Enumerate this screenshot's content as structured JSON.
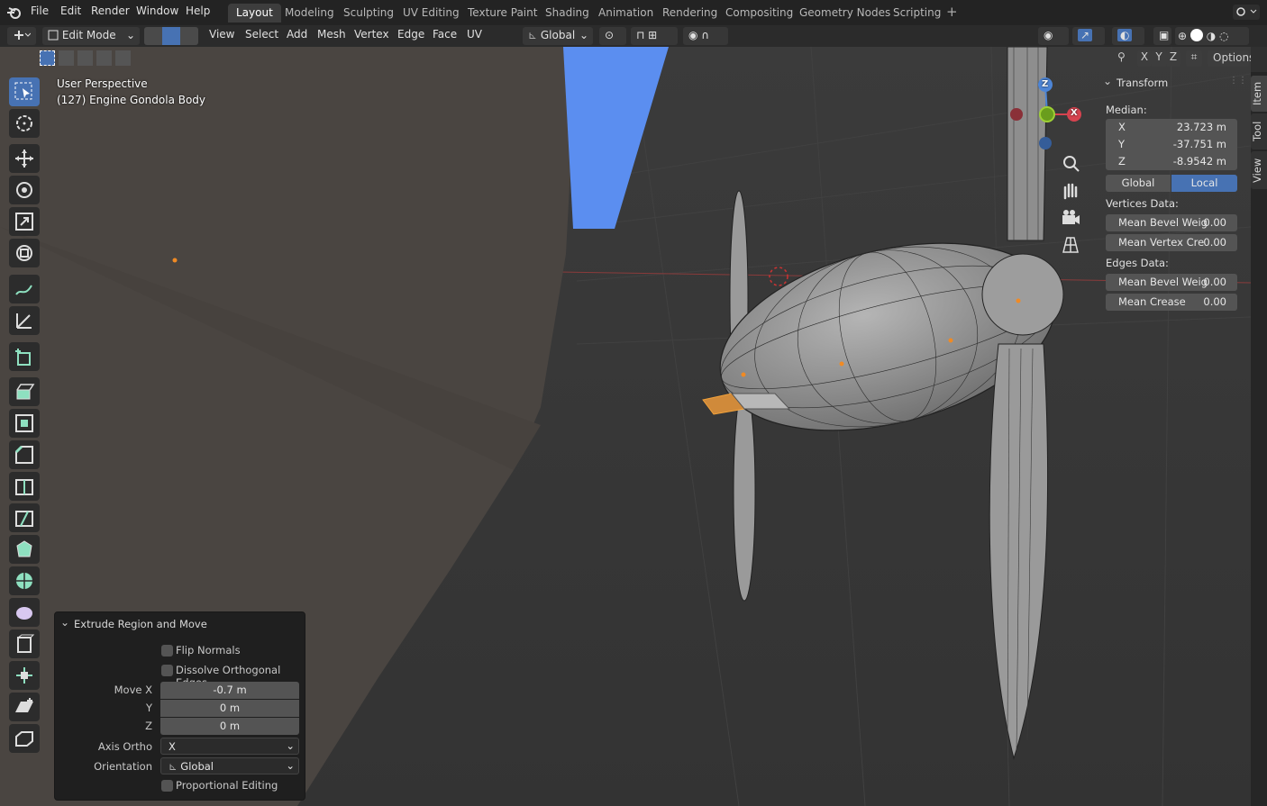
{
  "topbar": {
    "menus": [
      "File",
      "Edit",
      "Render",
      "Window",
      "Help"
    ],
    "workspaces": [
      "Layout",
      "Modeling",
      "Sculpting",
      "UV Editing",
      "Texture Paint",
      "Shading",
      "Animation",
      "Rendering",
      "Compositing",
      "Geometry Nodes",
      "Scripting"
    ],
    "active_workspace": "Layout",
    "add_tab": "+"
  },
  "header": {
    "mode": "Edit Mode",
    "menus": [
      "View",
      "Select",
      "Add",
      "Mesh",
      "Vertex",
      "Edge",
      "Face",
      "UV"
    ],
    "orientation": "Global",
    "options": "Options",
    "axes": [
      "X",
      "Y",
      "Z"
    ]
  },
  "viewport": {
    "perspective": "User Perspective",
    "object": "(127) Engine Gondola Body"
  },
  "gizmo": {
    "z": "Z",
    "x": "X"
  },
  "npanel": {
    "section": "Transform",
    "median_label": "Median:",
    "x_label": "X",
    "x_value": "23.723 m",
    "y_label": "Y",
    "y_value": "-37.751 m",
    "z_label": "Z",
    "z_value": "-8.9542 m",
    "global_btn": "Global",
    "local_btn": "Local",
    "vertices_data": "Vertices Data:",
    "mean_bevel_weight_v": "Mean Bevel Weig",
    "mean_bevel_weight_v_val": "0.00",
    "mean_vertex_crease": "Mean Vertex Cre",
    "mean_vertex_crease_val": "0.00",
    "edges_data": "Edges Data:",
    "mean_bevel_weight_e": "Mean Bevel Weig",
    "mean_bevel_weight_e_val": "0.00",
    "mean_crease": "Mean Crease",
    "mean_crease_val": "0.00"
  },
  "sidetabs": [
    "Item",
    "Tool",
    "View"
  ],
  "redo_panel": {
    "title": "Extrude Region and Move",
    "flip_normals": "Flip Normals",
    "dissolve": "Dissolve Orthogonal Edges",
    "move_x_label": "Move X",
    "move_x": "-0.7 m",
    "y_label": "Y",
    "y": "0 m",
    "z_label": "Z",
    "z": "0 m",
    "axis_ortho_label": "Axis Ortho",
    "axis_ortho": "X",
    "orientation_label": "Orientation",
    "orientation": "Global",
    "proportional": "Proportional Editing"
  },
  "colors": {
    "accent": "#4772b3",
    "bg": "#393939",
    "header": "#232323"
  }
}
